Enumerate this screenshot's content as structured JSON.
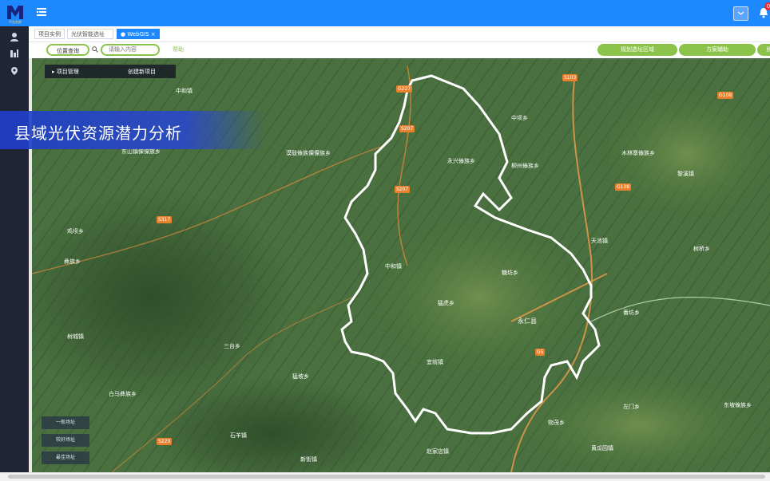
{
  "header": {
    "logo_text": "平台名称",
    "notification_count": "0"
  },
  "tabs": [
    {
      "label": "项目实例"
    },
    {
      "label": "光伏智能选址 ×"
    },
    {
      "label": "● WebGIS ×"
    }
  ],
  "toolbar": {
    "location_query": "位置查询",
    "search_placeholder": "请输入内容",
    "help": "帮助",
    "right_btn_1": "规划选址区域",
    "right_btn_2": "方案辅助",
    "right_btn_3": "统"
  },
  "project_panel": {
    "manage": "▸ 项目管理",
    "create": "创建新项目"
  },
  "banner": {
    "title": "县域光伏资源潜力分析"
  },
  "legend": [
    {
      "label": "一般场址"
    },
    {
      "label": "较好场址"
    },
    {
      "label": "最佳场址"
    }
  ],
  "map": {
    "places": [
      "中和镇",
      "东山镇傈僳族乡",
      "漠鼓傣族傈僳族乡",
      "永兴傣族乡",
      "柳州傣族乡",
      "中坝乡",
      "木林寨傣族乡",
      "黎溪镇",
      "天池镇",
      "树桥乡",
      "中和镇",
      "糖坊乡",
      "猛虎乡",
      "永仁县",
      "宜就镇",
      "鸡坝乡",
      "三台乡",
      "番坊乡",
      "彝族乡",
      "白马彝族乡",
      "猛坡乡",
      "石羊镇",
      "新街镇",
      "赵家店镇",
      "黄瓜园镇",
      "左门乡",
      "东坡傣族乡",
      "物茂乡",
      "树城镇"
    ],
    "roads": [
      "G227",
      "S207",
      "S207",
      "S317",
      "G108",
      "G5",
      "G108",
      "S220",
      "S103"
    ]
  }
}
